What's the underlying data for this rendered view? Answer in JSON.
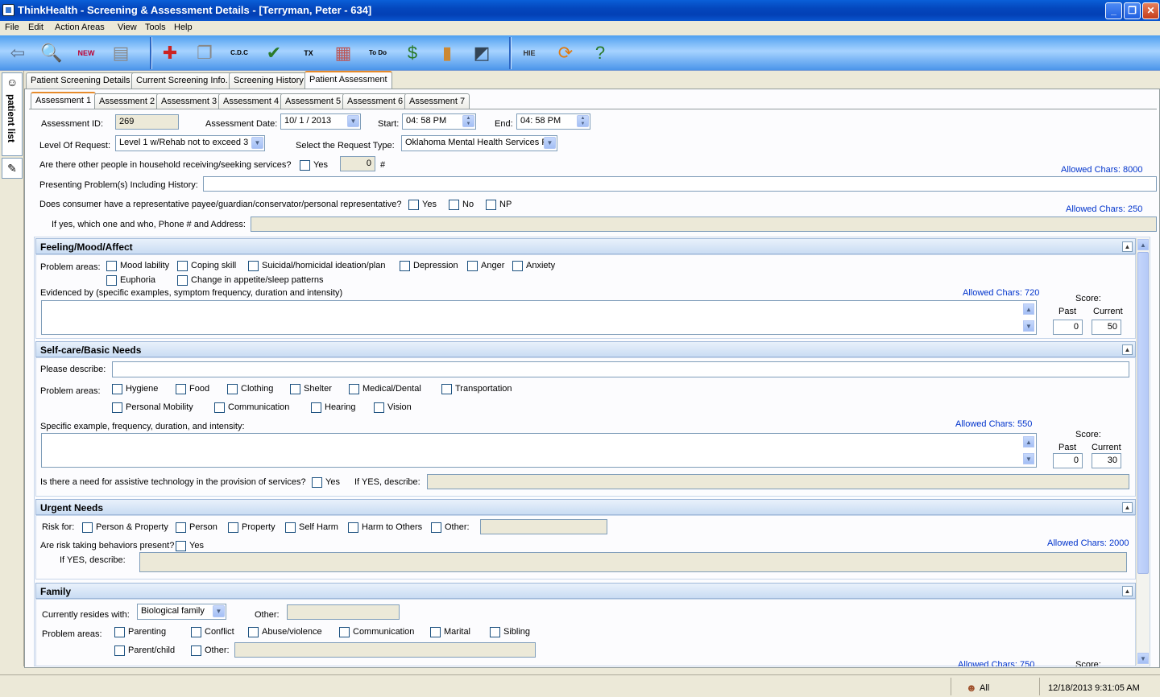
{
  "window": {
    "title": "ThinkHealth - Screening & Assessment Details  -  [Terryman, Peter - 634]",
    "minimize": "_",
    "restore": "❐",
    "close": "✕"
  },
  "menu": [
    "File",
    "Edit",
    "Action Areas",
    "View",
    "Tools",
    "Help"
  ],
  "toolbar": {
    "hie_label": "HIE",
    "cdc_label": "C.D.C",
    "tx_label": "TX",
    "new_label": "NEW",
    "todo_label": "To Do"
  },
  "sidebar": {
    "patient_list": "patient list"
  },
  "top_tabs": [
    "Patient Screening Details",
    "Current Screening Info.",
    "Screening History",
    "Patient Assessment"
  ],
  "assessment_tabs": [
    "Assessment 1",
    "Assessment 2",
    "Assessment 3",
    "Assessment 4",
    "Assessment 5",
    "Assessment 6",
    "Assessment 7"
  ],
  "form": {
    "assessment_id_label": "Assessment ID:",
    "assessment_id": "269",
    "assessment_date_label": "Assessment Date:",
    "assessment_date": "10/  1 / 2013",
    "start_label": "Start:",
    "start_time": "04:  58   PM",
    "end_label": "End:",
    "end_time": "04:  58   PM",
    "level_label": "Level Of Request:",
    "level_value": "Level 1 w/Rehab not to exceed 3",
    "request_type_label": "Select the Request Type:",
    "request_type_value": "Oklahoma Mental Health Services F",
    "household_q": "Are there other people in household receiving/seeking services?",
    "household_yes": "Yes",
    "household_count": "0",
    "household_hash": "#",
    "allowed_8000": "Allowed Chars: 8000",
    "presenting_label": "Presenting Problem(s) Including History:",
    "representative_q": "Does consumer have a representative payee/guardian/conservator/personal representative?",
    "rep_yes": "Yes",
    "rep_no": "No",
    "rep_np": "NP",
    "allowed_250": "Allowed Chars: 250",
    "rep_detail_label": "If yes, which one and who, Phone # and Address:"
  },
  "feeling": {
    "title": "Feeling/Mood/Affect",
    "problem_label": "Problem areas:",
    "options": [
      "Mood lability",
      "Coping skill",
      "Suicidal/homicidal ideation/plan",
      "Depression",
      "Anger",
      "Anxiety",
      "Euphoria",
      "Change in appetite/sleep patterns"
    ],
    "evidence_label": "Evidenced by (specific examples, symptom frequency, duration and intensity)",
    "allowed": "Allowed Chars: 720",
    "score_label": "Score:",
    "past_label": "Past",
    "current_label": "Current",
    "past": "0",
    "current": "50"
  },
  "selfcare": {
    "title": "Self-care/Basic Needs",
    "describe_label": "Please describe:",
    "problem_label": "Problem areas:",
    "options": [
      "Hygiene",
      "Food",
      "Clothing",
      "Shelter",
      "Medical/Dental",
      "Transportation",
      "Personal Mobility",
      "Communication",
      "Hearing",
      "Vision"
    ],
    "example_label": "Specific example, frequency, duration, and intensity:",
    "allowed": "Allowed Chars: 550",
    "score_label": "Score:",
    "past_label": "Past",
    "current_label": "Current",
    "past": "0",
    "current": "30",
    "assistive_q": "Is there a need for assistive technology in the provision of services?",
    "assistive_yes": "Yes",
    "ifyes_label": "If YES, describe:"
  },
  "urgent": {
    "title": "Urgent Needs",
    "risk_label": "Risk for:",
    "options": [
      "Person & Property",
      "Person",
      "Property",
      "Self Harm",
      "Harm to Others",
      "Other:"
    ],
    "risk_q": "Are risk taking behaviors present?",
    "risk_yes": "Yes",
    "allowed": "Allowed Chars: 2000",
    "ifyes_label": "If YES, describe:"
  },
  "family": {
    "title": "Family",
    "resides_label": "Currently resides with:",
    "resides_value": "Biological family",
    "other_label": "Other:",
    "problem_label": "Problem areas:",
    "options": [
      "Parenting",
      "Conflict",
      "Abuse/violence",
      "Communication",
      "Marital",
      "Sibling",
      "Parent/child",
      "Other:"
    ],
    "allowed_partial": "Allowed Chars: 750",
    "score_partial": "Score:"
  },
  "status": {
    "filter": "All",
    "datetime": "12/18/2013 9:31:05 AM"
  }
}
